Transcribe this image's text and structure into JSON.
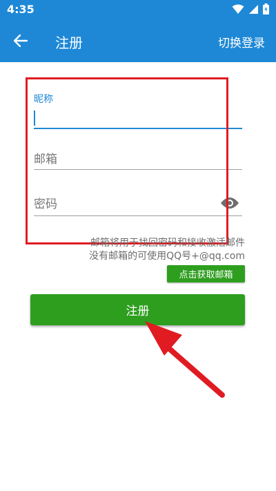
{
  "status_bar": {
    "time": "4:35"
  },
  "app_bar": {
    "title": "注册",
    "switch_login_label": "切换登录"
  },
  "form": {
    "nickname": {
      "label": "昵称",
      "value": ""
    },
    "email": {
      "placeholder": "邮箱",
      "value": ""
    },
    "password": {
      "placeholder": "密码",
      "value": ""
    }
  },
  "hint": {
    "line1": "邮箱将用于找回密码和接收激活邮件",
    "line2": "没有邮箱的可使用QQ号+@qq.com"
  },
  "buttons": {
    "get_email_label": "点击获取邮箱",
    "register_label": "注册"
  },
  "colors": {
    "primary": "#1e88d6",
    "button_green": "#2e9e1f",
    "annotation_red": "#e01b22"
  }
}
